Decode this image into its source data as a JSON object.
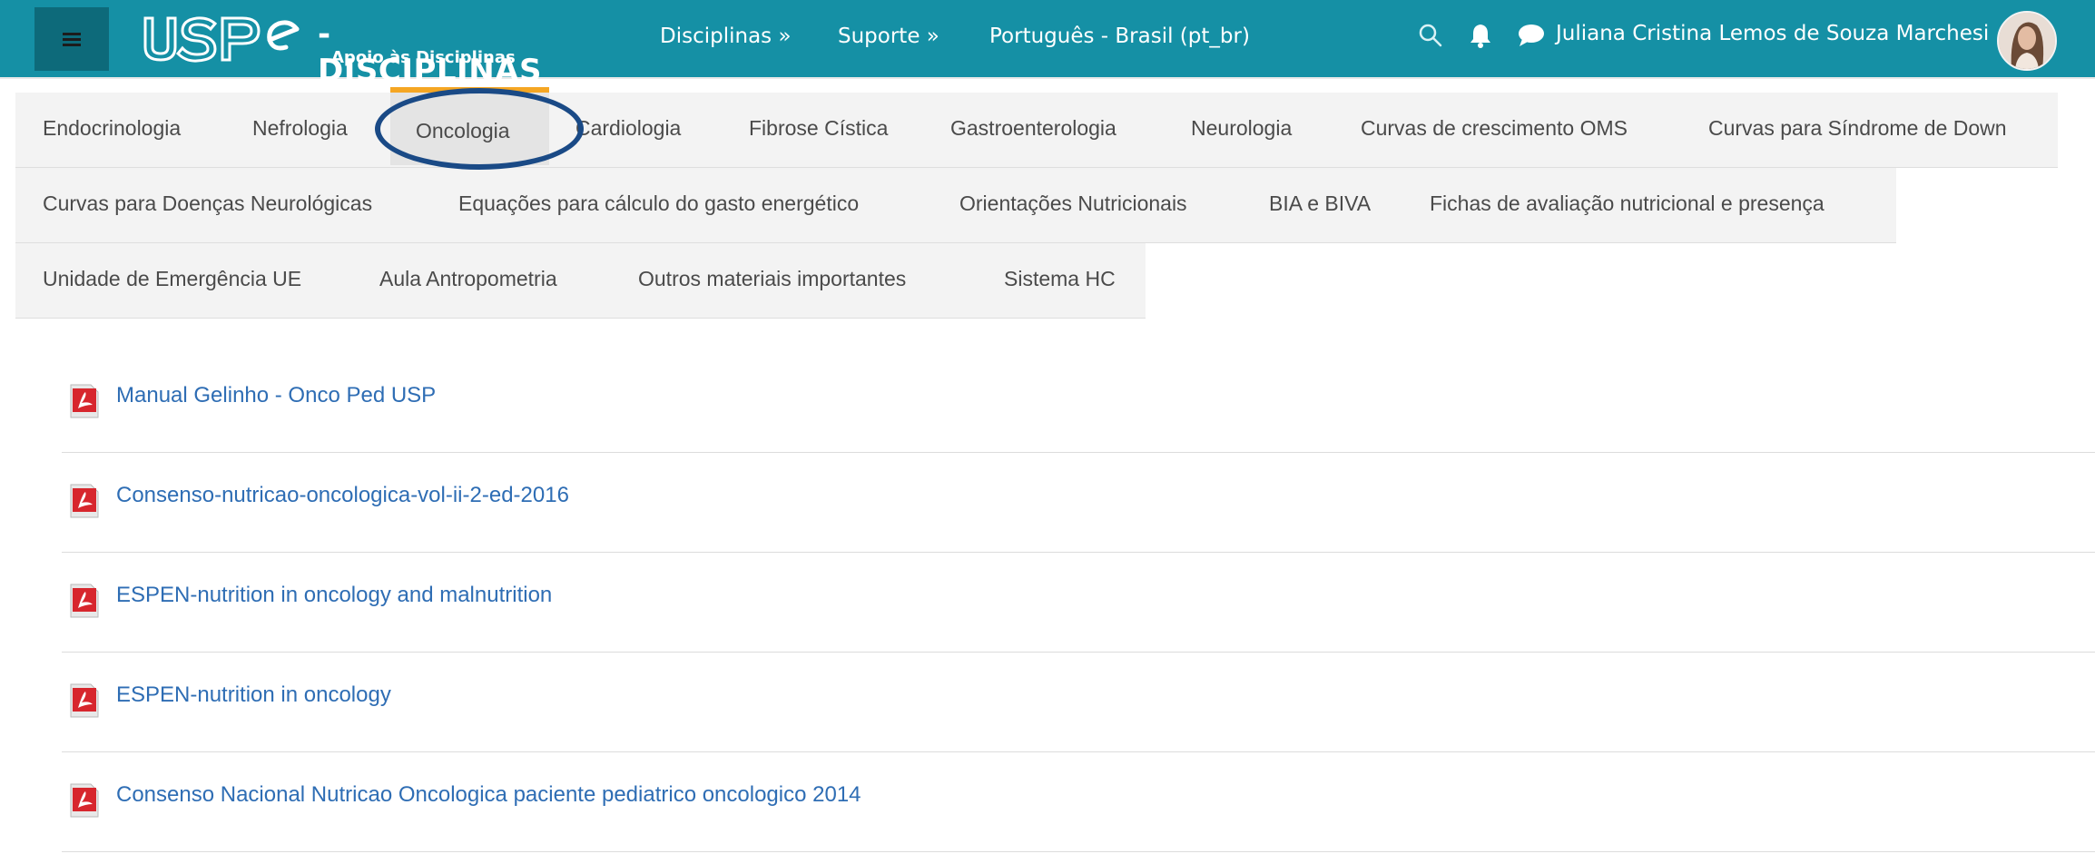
{
  "navbar": {
    "logo_text": "USP",
    "logo_title": "-DISCIPLINAS",
    "logo_subtitle": "Apoio às Disciplinas",
    "links": [
      {
        "label": "Disciplinas »"
      },
      {
        "label": "Suporte »"
      },
      {
        "label": "Português - Brasil (pt_br)"
      }
    ],
    "icons": [
      "search-icon",
      "bell-icon",
      "chat-icon"
    ],
    "user_name": "Juliana Cristina Lemos de Souza Marchesi",
    "brand_color": "#1590a5"
  },
  "tabs": {
    "row1": [
      "Endocrinologia",
      "Nefrologia",
      "Oncologia",
      "Cardiologia",
      "Fibrose Cística",
      "Gastroenterologia",
      "Neurologia",
      "Curvas de crescimento OMS",
      "Curvas para Síndrome de Down"
    ],
    "row2": [
      "Curvas para Doenças Neurológicas",
      "Equações para cálculo do gasto energético",
      "Orientações Nutricionais",
      "BIA e BIVA",
      "Fichas de avaliação nutricional e presença"
    ],
    "row3": [
      "Unidade de Emergência UE",
      "Aula Antropometria",
      "Outros materiais importantes",
      "Sistema HC"
    ],
    "active": "Oncologia",
    "active_color": "#f5a623"
  },
  "resources": [
    {
      "label": "Manual Gelinho - Onco Ped USP",
      "icon": "pdf-icon"
    },
    {
      "label": "Consenso-nutricao-oncologica-vol-ii-2-ed-2016",
      "icon": "pdf-icon"
    },
    {
      "label": "ESPEN-nutrition in oncology and malnutrition",
      "icon": "pdf-icon"
    },
    {
      "label": "ESPEN-nutrition in oncology",
      "icon": "pdf-icon"
    },
    {
      "label": "Consenso Nacional Nutricao Oncologica paciente pediatrico oncologico 2014",
      "icon": "pdf-icon"
    }
  ]
}
